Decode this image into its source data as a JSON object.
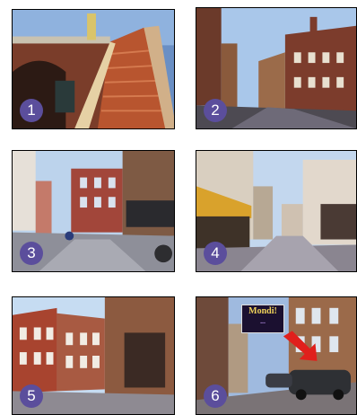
{
  "photos": [
    {
      "number": "1"
    },
    {
      "number": "2"
    },
    {
      "number": "3"
    },
    {
      "number": "4"
    },
    {
      "number": "5"
    },
    {
      "number": "6",
      "logo": {
        "line1": "Mondi!",
        "line2": "..."
      }
    }
  ],
  "colors": {
    "badge": "#5b4e9c",
    "arrow": "#e0201c"
  }
}
